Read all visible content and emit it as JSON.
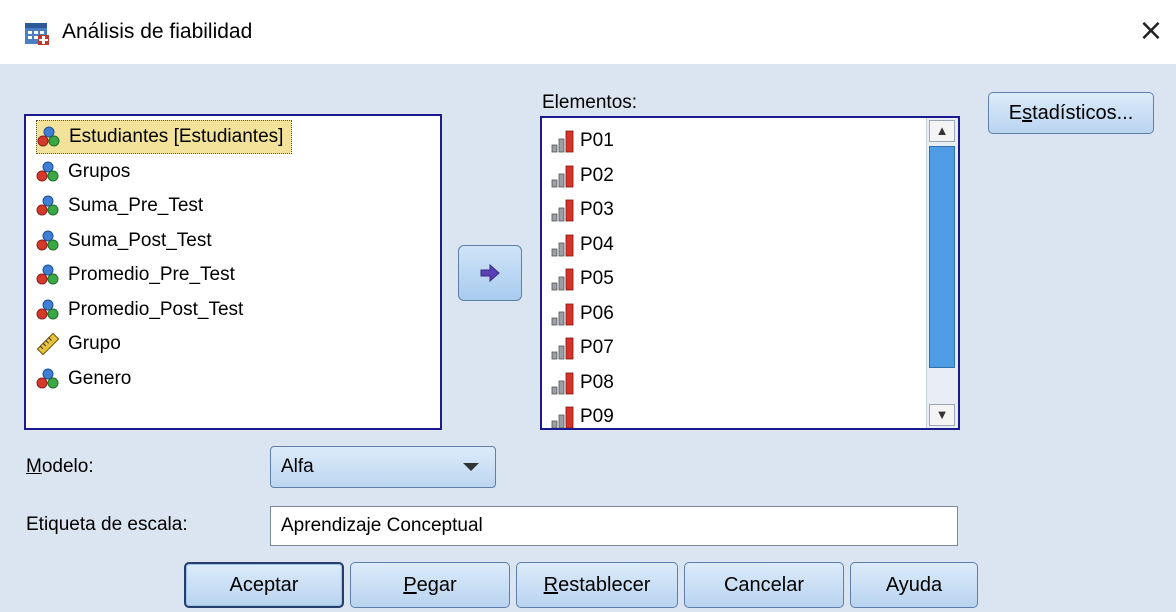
{
  "window": {
    "title": "Análisis de fiabilidad",
    "close_glyph": "×"
  },
  "source_list": {
    "items": [
      {
        "label": "Estudiantes [Estudiantes]",
        "icon": "nominal-variable-icon",
        "selected": true
      },
      {
        "label": "Grupos",
        "icon": "nominal-variable-icon",
        "selected": false
      },
      {
        "label": "Suma_Pre_Test",
        "icon": "nominal-variable-icon",
        "selected": false
      },
      {
        "label": "Suma_Post_Test",
        "icon": "nominal-variable-icon",
        "selected": false
      },
      {
        "label": "Promedio_Pre_Test",
        "icon": "nominal-variable-icon",
        "selected": false
      },
      {
        "label": "Promedio_Post_Test",
        "icon": "nominal-variable-icon",
        "selected": false
      },
      {
        "label": "Grupo",
        "icon": "scale-ruler-icon",
        "selected": false
      },
      {
        "label": "Genero",
        "icon": "nominal-variable-icon",
        "selected": false
      }
    ]
  },
  "target_list": {
    "label": "Elementos:",
    "items": [
      {
        "label": "P01",
        "icon": "ordinal-variable-icon"
      },
      {
        "label": "P02",
        "icon": "ordinal-variable-icon"
      },
      {
        "label": "P03",
        "icon": "ordinal-variable-icon"
      },
      {
        "label": "P04",
        "icon": "ordinal-variable-icon"
      },
      {
        "label": "P05",
        "icon": "ordinal-variable-icon"
      },
      {
        "label": "P06",
        "icon": "ordinal-variable-icon"
      },
      {
        "label": "P07",
        "icon": "ordinal-variable-icon"
      },
      {
        "label": "P08",
        "icon": "ordinal-variable-icon"
      },
      {
        "label": "P09",
        "icon": "ordinal-variable-icon"
      }
    ]
  },
  "buttons": {
    "statistics": {
      "pre": "E",
      "mnemonic": "s",
      "post": "tadísticos..."
    },
    "ok": "Aceptar",
    "paste": {
      "mnemonic": "P",
      "post": "egar"
    },
    "reset": {
      "mnemonic": "R",
      "post": "establecer"
    },
    "cancel": "Cancelar",
    "help": "Ayuda"
  },
  "model": {
    "label_mnemonic": "M",
    "label_post": "odelo:",
    "value": "Alfa"
  },
  "scale_label": {
    "label": "Etiqueta de escala:",
    "value": "Aprendizaje Conceptual"
  },
  "colors": {
    "dialog_bg": "#dbe5f1",
    "list_border": "#1b1b8f",
    "selection_bg": "#f3e39a",
    "scroll_thumb": "#4e9de4"
  }
}
